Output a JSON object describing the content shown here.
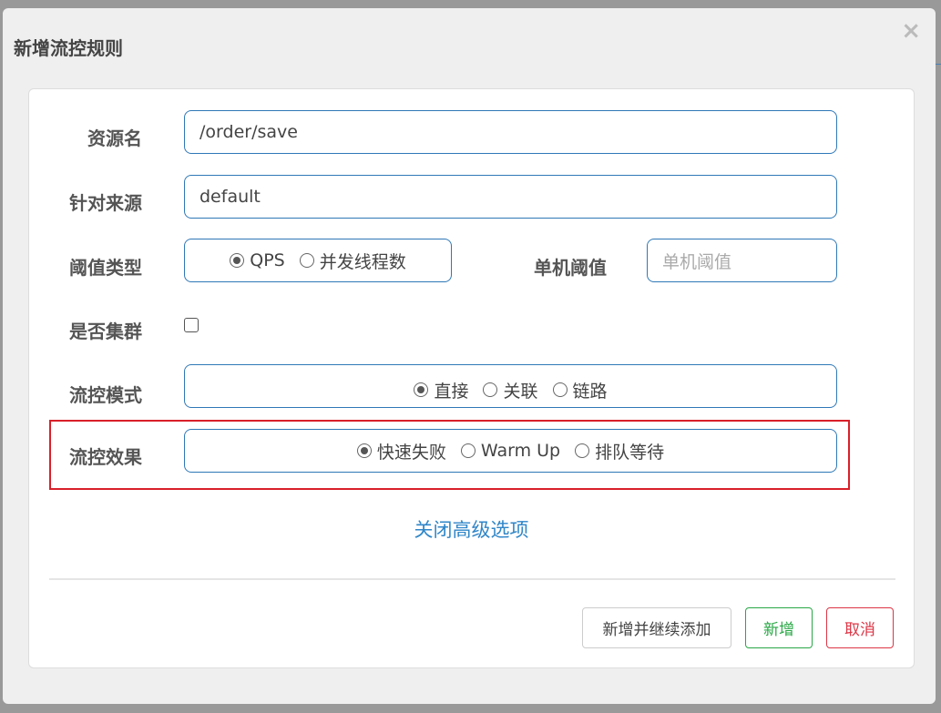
{
  "dialog": {
    "title": "新增流控规则",
    "close": "×"
  },
  "form": {
    "resource": {
      "label": "资源名",
      "value": "/order/save"
    },
    "origin": {
      "label": "针对来源",
      "value": "default"
    },
    "threshold_type": {
      "label": "阈值类型",
      "options": [
        "QPS",
        "并发线程数"
      ],
      "selected": 0
    },
    "threshold": {
      "label": "单机阈值",
      "placeholder": "单机阈值"
    },
    "cluster": {
      "label": "是否集群",
      "checked": false
    },
    "mode": {
      "label": "流控模式",
      "options": [
        "直接",
        "关联",
        "链路"
      ],
      "selected": 0
    },
    "effect": {
      "label": "流控效果",
      "options": [
        "快速失败",
        "Warm Up",
        "排队等待"
      ],
      "selected": 0
    }
  },
  "advanced_link": "关闭高级选项",
  "buttons": {
    "add_continue": "新增并继续添加",
    "add": "新增",
    "cancel": "取消"
  },
  "colors": {
    "highlight": "#d9202a",
    "add": "#28a745",
    "cancel": "#dc3545",
    "link": "#2f86c8"
  }
}
